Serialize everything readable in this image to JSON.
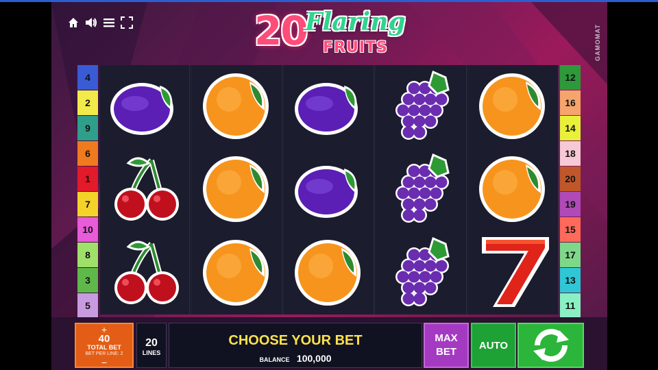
{
  "header": {
    "icons": [
      "home-icon",
      "sound-icon",
      "menu-icon",
      "fullscreen-icon"
    ],
    "logo": {
      "number": "20",
      "word1": "Flaring",
      "word2": "FRUITS"
    },
    "provider": "GAMOMAT"
  },
  "paylines": {
    "left": [
      {
        "label": "4",
        "color": "#3a5bd6"
      },
      {
        "label": "2",
        "color": "#f2ea4a"
      },
      {
        "label": "9",
        "color": "#2f9e8a"
      },
      {
        "label": "6",
        "color": "#f07a1e"
      },
      {
        "label": "1",
        "color": "#e21a2a"
      },
      {
        "label": "7",
        "color": "#f4d22a"
      },
      {
        "label": "10",
        "color": "#e85bd9"
      },
      {
        "label": "8",
        "color": "#9ee06a"
      },
      {
        "label": "3",
        "color": "#5fb84a"
      },
      {
        "label": "5",
        "color": "#c89be0"
      }
    ],
    "right": [
      {
        "label": "12",
        "color": "#2d9a3a"
      },
      {
        "label": "16",
        "color": "#f5a56b"
      },
      {
        "label": "14",
        "color": "#e9f03a"
      },
      {
        "label": "18",
        "color": "#f7c8d6"
      },
      {
        "label": "20",
        "color": "#c0572a"
      },
      {
        "label": "19",
        "color": "#b04ab8"
      },
      {
        "label": "15",
        "color": "#ff6a5a"
      },
      {
        "label": "17",
        "color": "#7ed88a"
      },
      {
        "label": "13",
        "color": "#2fc7d6"
      },
      {
        "label": "11",
        "color": "#8af0c4"
      }
    ]
  },
  "reels": [
    [
      "plum",
      "cherry",
      "cherry"
    ],
    [
      "orange",
      "orange",
      "orange"
    ],
    [
      "plum",
      "plum",
      "orange"
    ],
    [
      "grapes",
      "grapes",
      "grapes"
    ],
    [
      "orange",
      "orange",
      "seven"
    ]
  ],
  "controls": {
    "total_bet_plus": "+",
    "total_bet_value": "40",
    "total_bet_label": "TOTAL BET",
    "bet_per_line_label": "BET PER LINE: 2",
    "total_bet_minus": "−",
    "lines_value": "20",
    "lines_label": "LINES",
    "message": "CHOOSE YOUR BET",
    "balance_label": "BALANCE",
    "balance_value": "100,000",
    "max_bet_line1": "MAX",
    "max_bet_line2": "BET",
    "auto_label": "AUTO"
  }
}
